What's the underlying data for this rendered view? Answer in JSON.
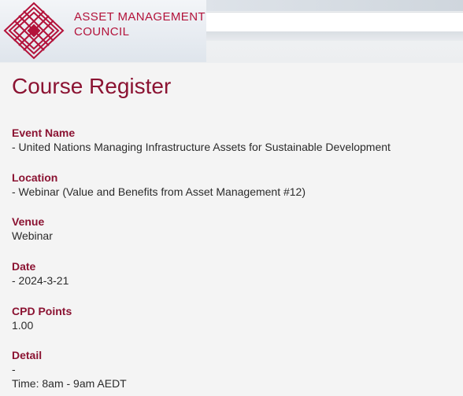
{
  "logo": {
    "line1": "ASSET MANAGEMENT",
    "line2": "COUNCIL",
    "icon": "amc-lattice-logo-icon",
    "brand_color": "#b3123a"
  },
  "page": {
    "title": "Course Register",
    "accent_color": "#8b1332"
  },
  "fields": {
    "event_name": {
      "label": "Event Name",
      "value": "- United Nations Managing Infrastructure Assets for Sustainable Development"
    },
    "location": {
      "label": "Location",
      "value": "- Webinar (Value and Benefits from Asset Management #12)"
    },
    "venue": {
      "label": "Venue",
      "value": "Webinar"
    },
    "date": {
      "label": "Date",
      "value": "- 2024-3-21"
    },
    "cpd_points": {
      "label": "CPD Points",
      "value": "1.00"
    },
    "detail": {
      "label": "Detail",
      "value_line1": "-",
      "value_line2": "Time: 8am - 9am AEDT"
    }
  }
}
